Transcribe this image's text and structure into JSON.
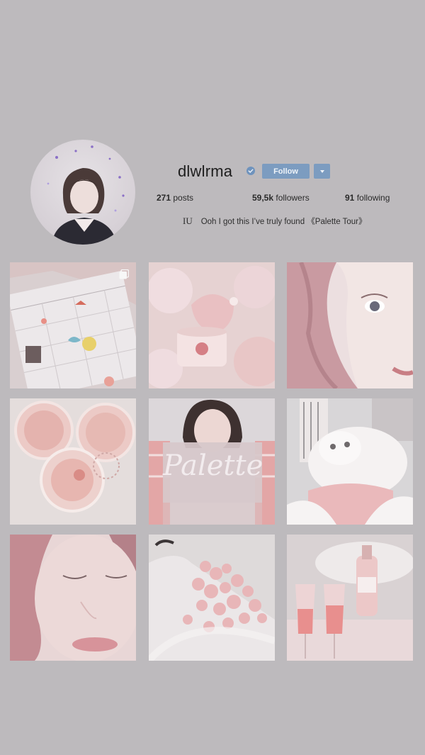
{
  "profile": {
    "username": "dlwlrma",
    "follow_label": "Follow",
    "stats": {
      "posts_count": "271",
      "posts_label": "posts",
      "followers_count": "59,5k",
      "followers_label": "followers",
      "following_count": "91",
      "following_label": "following"
    },
    "bio_name": "IU",
    "bio_text": "Ooh I got this I’ve truly found 《Palette Tour》"
  },
  "icons": {
    "verified": "verified-badge-icon",
    "dropdown": "chevron-down-icon",
    "multi_photo": "multiple-photos-icon"
  },
  "colors": {
    "background": "#bdbabd",
    "accent": "#7c9cc0"
  },
  "grid": {
    "posts": [
      {
        "id": "post-1",
        "overlay_text": ""
      },
      {
        "id": "post-2",
        "overlay_text": ""
      },
      {
        "id": "post-3",
        "overlay_text": ""
      },
      {
        "id": "post-4",
        "overlay_text": ""
      },
      {
        "id": "post-5",
        "overlay_text": "Palette"
      },
      {
        "id": "post-6",
        "overlay_text": ""
      },
      {
        "id": "post-7",
        "overlay_text": ""
      },
      {
        "id": "post-8",
        "overlay_text": ""
      },
      {
        "id": "post-9",
        "overlay_text": ""
      }
    ]
  }
}
